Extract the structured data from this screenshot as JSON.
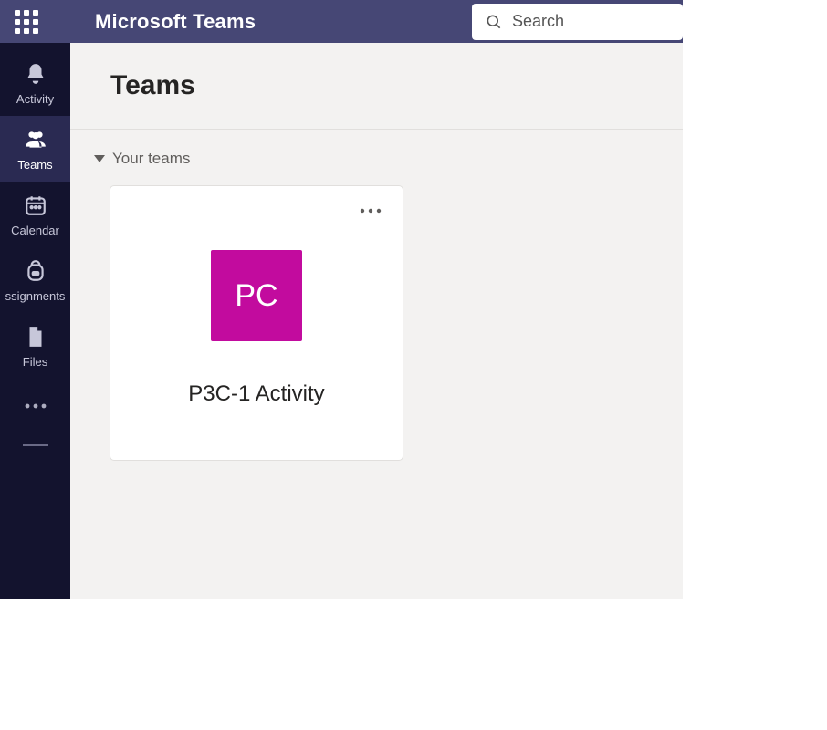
{
  "app_title": "Microsoft Teams",
  "search": {
    "placeholder": "Search"
  },
  "rail": {
    "items": [
      {
        "key": "activity",
        "label": "Activity"
      },
      {
        "key": "teams",
        "label": "Teams"
      },
      {
        "key": "calendar",
        "label": "Calendar"
      },
      {
        "key": "assignments",
        "label": "ssignments"
      },
      {
        "key": "files",
        "label": "Files"
      }
    ]
  },
  "page_title": "Teams",
  "section_label": "Your teams",
  "teams": [
    {
      "initials": "PC",
      "name": "P3C-1 Activity",
      "tile_color": "#c20b9e"
    }
  ]
}
